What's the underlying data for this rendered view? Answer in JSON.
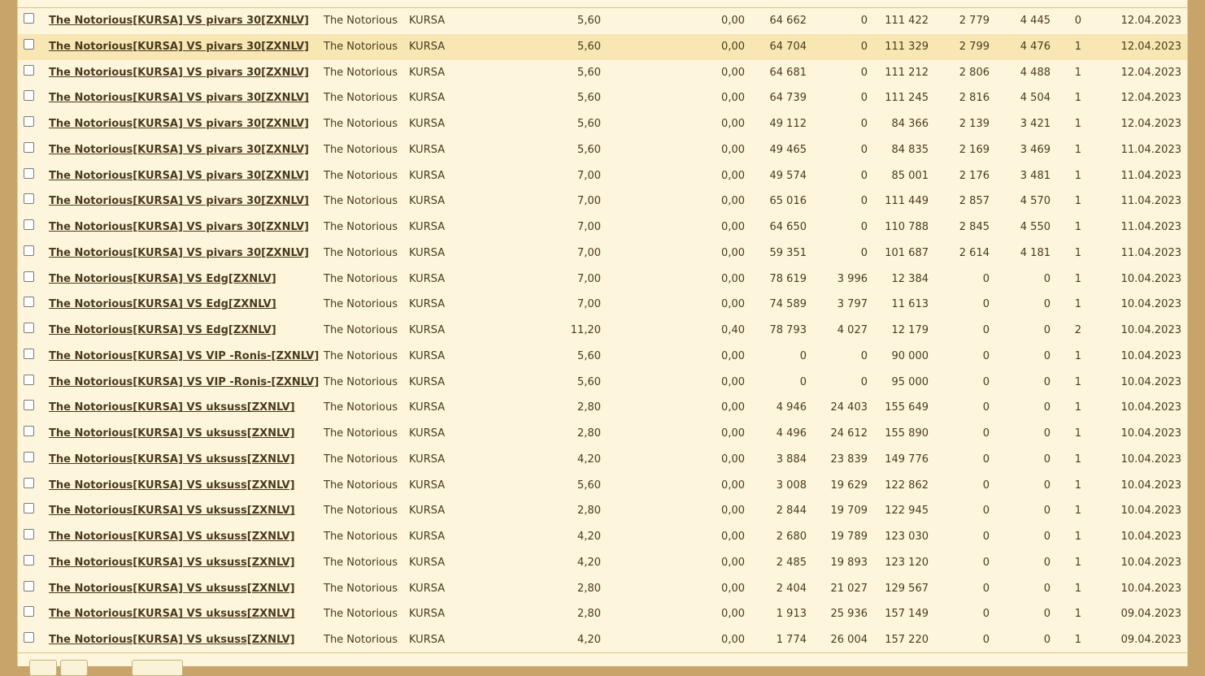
{
  "table": {
    "rows": [
      {
        "match": "The Notorious[KURSA] VS pivars 30[ZXNLV]",
        "team": "The Notorious",
        "tag": "KURSA",
        "a": "5,60",
        "b": "0,00",
        "c": "64 662",
        "d": "0",
        "e": "111 422",
        "f": "2 779",
        "g": "4 445",
        "h": "0",
        "date": "12.04.2023"
      },
      {
        "match": "The Notorious[KURSA] VS pivars 30[ZXNLV]",
        "team": "The Notorious",
        "tag": "KURSA",
        "a": "5,60",
        "b": "0,00",
        "c": "64 704",
        "d": "0",
        "e": "111 329",
        "f": "2 799",
        "g": "4 476",
        "h": "1",
        "date": "12.04.2023"
      },
      {
        "match": "The Notorious[KURSA] VS pivars 30[ZXNLV]",
        "team": "The Notorious",
        "tag": "KURSA",
        "a": "5,60",
        "b": "0,00",
        "c": "64 681",
        "d": "0",
        "e": "111 212",
        "f": "2 806",
        "g": "4 488",
        "h": "1",
        "date": "12.04.2023"
      },
      {
        "match": "The Notorious[KURSA] VS pivars 30[ZXNLV]",
        "team": "The Notorious",
        "tag": "KURSA",
        "a": "5,60",
        "b": "0,00",
        "c": "64 739",
        "d": "0",
        "e": "111 245",
        "f": "2 816",
        "g": "4 504",
        "h": "1",
        "date": "12.04.2023"
      },
      {
        "match": "The Notorious[KURSA] VS pivars 30[ZXNLV]",
        "team": "The Notorious",
        "tag": "KURSA",
        "a": "5,60",
        "b": "0,00",
        "c": "49 112",
        "d": "0",
        "e": "84 366",
        "f": "2 139",
        "g": "3 421",
        "h": "1",
        "date": "12.04.2023"
      },
      {
        "match": "The Notorious[KURSA] VS pivars 30[ZXNLV]",
        "team": "The Notorious",
        "tag": "KURSA",
        "a": "5,60",
        "b": "0,00",
        "c": "49 465",
        "d": "0",
        "e": "84 835",
        "f": "2 169",
        "g": "3 469",
        "h": "1",
        "date": "11.04.2023"
      },
      {
        "match": "The Notorious[KURSA] VS pivars 30[ZXNLV]",
        "team": "The Notorious",
        "tag": "KURSA",
        "a": "7,00",
        "b": "0,00",
        "c": "49 574",
        "d": "0",
        "e": "85 001",
        "f": "2 176",
        "g": "3 481",
        "h": "1",
        "date": "11.04.2023"
      },
      {
        "match": "The Notorious[KURSA] VS pivars 30[ZXNLV]",
        "team": "The Notorious",
        "tag": "KURSA",
        "a": "7,00",
        "b": "0,00",
        "c": "65 016",
        "d": "0",
        "e": "111 449",
        "f": "2 857",
        "g": "4 570",
        "h": "1",
        "date": "11.04.2023"
      },
      {
        "match": "The Notorious[KURSA] VS pivars 30[ZXNLV]",
        "team": "The Notorious",
        "tag": "KURSA",
        "a": "7,00",
        "b": "0,00",
        "c": "64 650",
        "d": "0",
        "e": "110 788",
        "f": "2 845",
        "g": "4 550",
        "h": "1",
        "date": "11.04.2023"
      },
      {
        "match": "The Notorious[KURSA] VS pivars 30[ZXNLV]",
        "team": "The Notorious",
        "tag": "KURSA",
        "a": "7,00",
        "b": "0,00",
        "c": "59 351",
        "d": "0",
        "e": "101 687",
        "f": "2 614",
        "g": "4 181",
        "h": "1",
        "date": "11.04.2023"
      },
      {
        "match": "The Notorious[KURSA] VS Edg[ZXNLV]",
        "team": "The Notorious",
        "tag": "KURSA",
        "a": "7,00",
        "b": "0,00",
        "c": "78 619",
        "d": "3 996",
        "e": "12 384",
        "f": "0",
        "g": "0",
        "h": "1",
        "date": "10.04.2023"
      },
      {
        "match": "The Notorious[KURSA] VS Edg[ZXNLV]",
        "team": "The Notorious",
        "tag": "KURSA",
        "a": "7,00",
        "b": "0,00",
        "c": "74 589",
        "d": "3 797",
        "e": "11 613",
        "f": "0",
        "g": "0",
        "h": "1",
        "date": "10.04.2023"
      },
      {
        "match": "The Notorious[KURSA] VS Edg[ZXNLV]",
        "team": "The Notorious",
        "tag": "KURSA",
        "a": "11,20",
        "b": "0,40",
        "c": "78 793",
        "d": "4 027",
        "e": "12 179",
        "f": "0",
        "g": "0",
        "h": "2",
        "date": "10.04.2023"
      },
      {
        "match": "The Notorious[KURSA] VS VIP -Ronis-[ZXNLV]",
        "team": "The Notorious",
        "tag": "KURSA",
        "a": "5,60",
        "b": "0,00",
        "c": "0",
        "d": "0",
        "e": "90 000",
        "f": "0",
        "g": "0",
        "h": "1",
        "date": "10.04.2023"
      },
      {
        "match": "The Notorious[KURSA] VS VIP -Ronis-[ZXNLV]",
        "team": "The Notorious",
        "tag": "KURSA",
        "a": "5,60",
        "b": "0,00",
        "c": "0",
        "d": "0",
        "e": "95 000",
        "f": "0",
        "g": "0",
        "h": "1",
        "date": "10.04.2023"
      },
      {
        "match": "The Notorious[KURSA] VS uksuss[ZXNLV]",
        "team": "The Notorious",
        "tag": "KURSA",
        "a": "2,80",
        "b": "0,00",
        "c": "4 946",
        "d": "24 403",
        "e": "155 649",
        "f": "0",
        "g": "0",
        "h": "1",
        "date": "10.04.2023"
      },
      {
        "match": "The Notorious[KURSA] VS uksuss[ZXNLV]",
        "team": "The Notorious",
        "tag": "KURSA",
        "a": "2,80",
        "b": "0,00",
        "c": "4 496",
        "d": "24 612",
        "e": "155 890",
        "f": "0",
        "g": "0",
        "h": "1",
        "date": "10.04.2023"
      },
      {
        "match": "The Notorious[KURSA] VS uksuss[ZXNLV]",
        "team": "The Notorious",
        "tag": "KURSA",
        "a": "4,20",
        "b": "0,00",
        "c": "3 884",
        "d": "23 839",
        "e": "149 776",
        "f": "0",
        "g": "0",
        "h": "1",
        "date": "10.04.2023"
      },
      {
        "match": "The Notorious[KURSA] VS uksuss[ZXNLV]",
        "team": "The Notorious",
        "tag": "KURSA",
        "a": "5,60",
        "b": "0,00",
        "c": "3 008",
        "d": "19 629",
        "e": "122 862",
        "f": "0",
        "g": "0",
        "h": "1",
        "date": "10.04.2023"
      },
      {
        "match": "The Notorious[KURSA] VS uksuss[ZXNLV]",
        "team": "The Notorious",
        "tag": "KURSA",
        "a": "2,80",
        "b": "0,00",
        "c": "2 844",
        "d": "19 709",
        "e": "122 945",
        "f": "0",
        "g": "0",
        "h": "1",
        "date": "10.04.2023"
      },
      {
        "match": "The Notorious[KURSA] VS uksuss[ZXNLV]",
        "team": "The Notorious",
        "tag": "KURSA",
        "a": "4,20",
        "b": "0,00",
        "c": "2 680",
        "d": "19 789",
        "e": "123 030",
        "f": "0",
        "g": "0",
        "h": "1",
        "date": "10.04.2023"
      },
      {
        "match": "The Notorious[KURSA] VS uksuss[ZXNLV]",
        "team": "The Notorious",
        "tag": "KURSA",
        "a": "4,20",
        "b": "0,00",
        "c": "2 485",
        "d": "19 893",
        "e": "123 120",
        "f": "0",
        "g": "0",
        "h": "1",
        "date": "10.04.2023"
      },
      {
        "match": "The Notorious[KURSA] VS uksuss[ZXNLV]",
        "team": "The Notorious",
        "tag": "KURSA",
        "a": "2,80",
        "b": "0,00",
        "c": "2 404",
        "d": "21 027",
        "e": "129 567",
        "f": "0",
        "g": "0",
        "h": "1",
        "date": "10.04.2023"
      },
      {
        "match": "The Notorious[KURSA] VS uksuss[ZXNLV]",
        "team": "The Notorious",
        "tag": "KURSA",
        "a": "2,80",
        "b": "0,00",
        "c": "1 913",
        "d": "25 936",
        "e": "157 149",
        "f": "0",
        "g": "0",
        "h": "1",
        "date": "09.04.2023"
      },
      {
        "match": "The Notorious[KURSA] VS uksuss[ZXNLV]",
        "team": "The Notorious",
        "tag": "KURSA",
        "a": "4,20",
        "b": "0,00",
        "c": "1 774",
        "d": "26 004",
        "e": "157 220",
        "f": "0",
        "g": "0",
        "h": "1",
        "date": "09.04.2023"
      }
    ]
  }
}
